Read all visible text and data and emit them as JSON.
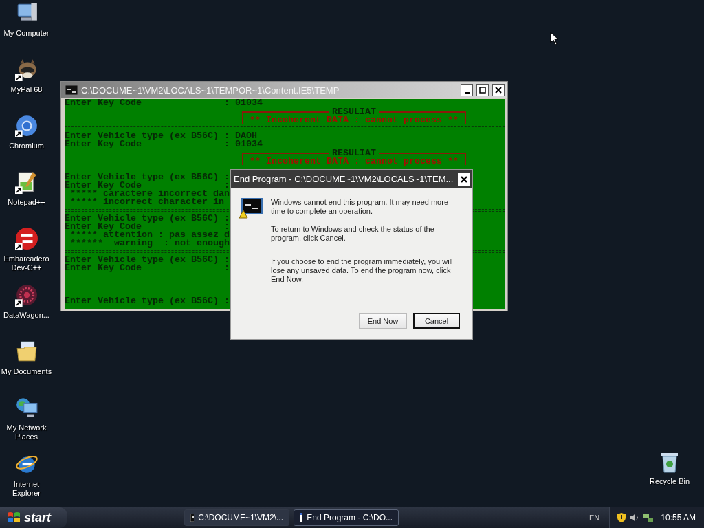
{
  "desktop_icons": [
    {
      "label": "My Computer",
      "kind": "computer",
      "shortcut": false
    },
    {
      "label": "MyPal 68",
      "kind": "animal",
      "shortcut": true
    },
    {
      "label": "Chromium",
      "kind": "ring",
      "shortcut": true
    },
    {
      "label": "Notepad++",
      "kind": "notepad",
      "shortcut": true
    },
    {
      "label": "Embarcadero Dev-C++",
      "kind": "devcpp",
      "shortcut": true
    },
    {
      "label": "DataWagon...",
      "kind": "burst",
      "shortcut": true
    },
    {
      "label": "My Documents",
      "kind": "documents",
      "shortcut": false
    },
    {
      "label": "My Network Places",
      "kind": "network",
      "shortcut": false
    },
    {
      "label": "Internet Explorer",
      "kind": "explorer",
      "shortcut": false
    }
  ],
  "recycle_bin": {
    "label": "Recycle Bin"
  },
  "console_window": {
    "title": "C:\\DOCUME~1\\VM2\\LOCALS~1\\TEMPOR~1\\Content.IE5\\TEMP",
    "lines": [
      {
        "kind": "text",
        "text": "Enter Key Code               : 01034"
      },
      {
        "kind": "result",
        "title": "RESULIAT",
        "message": "** Incoherent DATA : cannot process **"
      },
      {
        "kind": "separator"
      },
      {
        "kind": "text",
        "text": "Enter Vehicle type (ex B56C) : DAOH"
      },
      {
        "kind": "text",
        "text": "Enter Key Code               : 01034"
      },
      {
        "kind": "result",
        "title": "RESULIAT",
        "message": "** Incoherent DATA : cannot process **"
      },
      {
        "kind": "separator"
      },
      {
        "kind": "text",
        "text": "Enter Vehicle type (ex B56C) :"
      },
      {
        "kind": "text",
        "text": "Enter Key Code               :"
      },
      {
        "kind": "text",
        "text": " ***** caractere incorrect dan"
      },
      {
        "kind": "text",
        "text": " ***** incorrect character in"
      },
      {
        "kind": "separator"
      },
      {
        "kind": "text",
        "text": "Enter Vehicle type (ex B56C) :"
      },
      {
        "kind": "text",
        "text": "Enter Key Code               :"
      },
      {
        "kind": "text",
        "text": " ***** attention : pas assez d"
      },
      {
        "kind": "text",
        "text": " ******  warning  : not enough"
      },
      {
        "kind": "separator"
      },
      {
        "kind": "text",
        "text": "Enter Vehicle type (ex B56C) :"
      },
      {
        "kind": "text",
        "text": "Enter Key Code               :"
      },
      {
        "kind": "blank"
      },
      {
        "kind": "blank"
      },
      {
        "kind": "separator"
      },
      {
        "kind": "text",
        "text": "Enter Vehicle type (ex B56C) :"
      }
    ]
  },
  "dialog": {
    "title": "End Program - C:\\DOCUME~1\\VM2\\LOCALS~1\\TEM...",
    "paragraphs": [
      "Windows cannot end this program. It may need more time to complete an operation.",
      "To return to Windows and check the status of the program, click Cancel.",
      "If you choose to end the program immediately, you will lose any unsaved data. To end the program now, click End Now."
    ],
    "buttons": [
      {
        "label": "End Now",
        "default": false
      },
      {
        "label": "Cancel",
        "default": true
      }
    ]
  },
  "taskbar": {
    "start": "start",
    "tasks": [
      {
        "label": "C:\\DOCUME~1\\VM2\\...",
        "kind": "console",
        "selected": false
      },
      {
        "label": "End Program - C:\\DO...",
        "kind": "window",
        "selected": true
      }
    ],
    "language": "EN",
    "clock": "10:55 AM"
  }
}
